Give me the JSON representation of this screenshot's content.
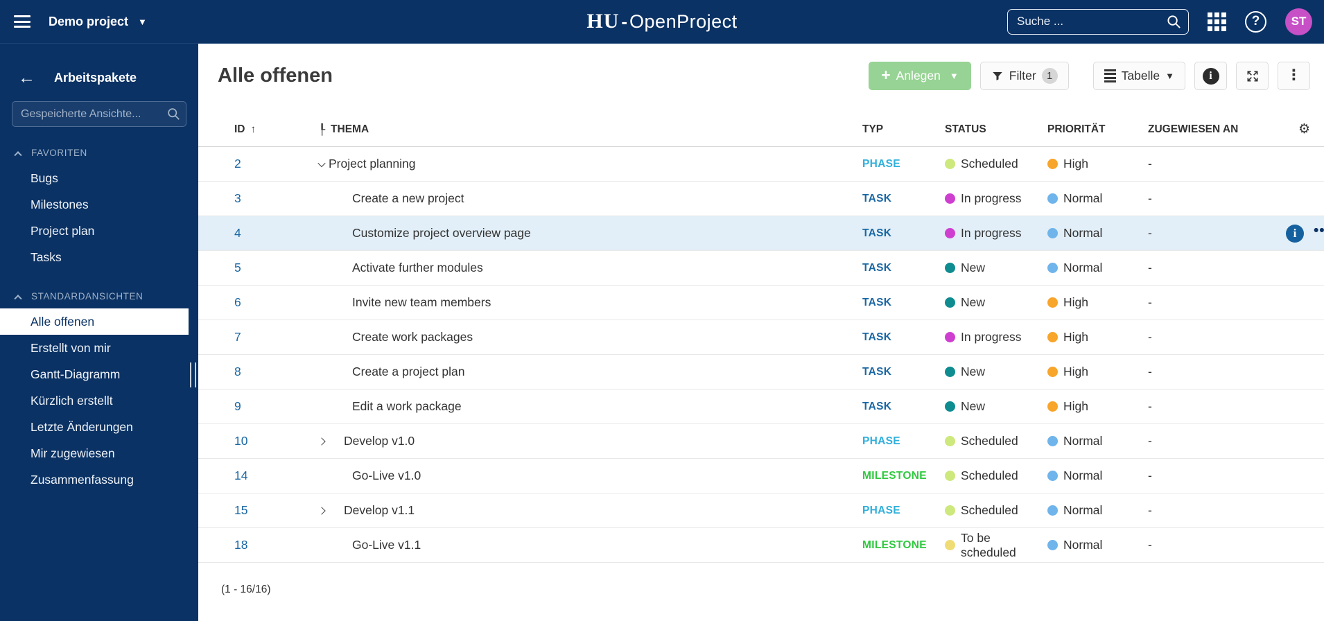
{
  "topbar": {
    "project_name": "Demo project",
    "logo": {
      "serif": "HU",
      "dash": "-",
      "sans": "OpenProject"
    },
    "search_placeholder": "Suche ...",
    "avatar_initials": "ST"
  },
  "sidebar": {
    "title": "Arbeitspakete",
    "search_placeholder": "Gespeicherte Ansichte...",
    "sections": [
      {
        "label": "FAVORITEN",
        "items": [
          {
            "label": "Bugs",
            "selected": false
          },
          {
            "label": "Milestones",
            "selected": false
          },
          {
            "label": "Project plan",
            "selected": false
          },
          {
            "label": "Tasks",
            "selected": false
          }
        ]
      },
      {
        "label": "STANDARDANSICHTEN",
        "items": [
          {
            "label": "Alle offenen",
            "selected": true
          },
          {
            "label": "Erstellt von mir",
            "selected": false
          },
          {
            "label": "Gantt-Diagramm",
            "selected": false
          },
          {
            "label": "Kürzlich erstellt",
            "selected": false
          },
          {
            "label": "Letzte Änderungen",
            "selected": false
          },
          {
            "label": "Mir zugewiesen",
            "selected": false
          },
          {
            "label": "Zusammenfassung",
            "selected": false
          }
        ]
      }
    ]
  },
  "main": {
    "title": "Alle offenen",
    "toolbar": {
      "create_label": "Anlegen",
      "filter_label": "Filter",
      "filter_count": "1",
      "table_label": "Tabelle"
    },
    "table": {
      "columns": {
        "id": "ID",
        "thema": "THEMA",
        "typ": "TYP",
        "status": "STATUS",
        "prioritaet": "PRIORITÄT",
        "zugewiesen": "ZUGEWIESEN AN"
      },
      "rows": [
        {
          "id": "2",
          "subject": "Project planning",
          "level": 0,
          "chevron": "down",
          "type": "PHASE",
          "type_color": "#2FB0DC",
          "status": "Scheduled",
          "status_color": "#CDE87C",
          "priority": "High",
          "priority_color": "#F7A52B",
          "assignee": "-",
          "highlighted": false
        },
        {
          "id": "3",
          "subject": "Create a new project",
          "level": 1,
          "chevron": null,
          "type": "TASK",
          "type_color": "#1A67A3",
          "status": "In progress",
          "status_color": "#CE3FD0",
          "priority": "Normal",
          "priority_color": "#6FB4EB",
          "assignee": "-",
          "highlighted": false
        },
        {
          "id": "4",
          "subject": "Customize project overview page",
          "level": 1,
          "chevron": null,
          "type": "TASK",
          "type_color": "#1A67A3",
          "status": "In progress",
          "status_color": "#CE3FD0",
          "priority": "Normal",
          "priority_color": "#6FB4EB",
          "assignee": "-",
          "highlighted": true
        },
        {
          "id": "5",
          "subject": "Activate further modules",
          "level": 1,
          "chevron": null,
          "type": "TASK",
          "type_color": "#1A67A3",
          "status": "New",
          "status_color": "#0E8C90",
          "priority": "Normal",
          "priority_color": "#6FB4EB",
          "assignee": "-",
          "highlighted": false
        },
        {
          "id": "6",
          "subject": "Invite new team members",
          "level": 1,
          "chevron": null,
          "type": "TASK",
          "type_color": "#1A67A3",
          "status": "New",
          "status_color": "#0E8C90",
          "priority": "High",
          "priority_color": "#F7A52B",
          "assignee": "-",
          "highlighted": false
        },
        {
          "id": "7",
          "subject": "Create work packages",
          "level": 1,
          "chevron": null,
          "type": "TASK",
          "type_color": "#1A67A3",
          "status": "In progress",
          "status_color": "#CE3FD0",
          "priority": "High",
          "priority_color": "#F7A52B",
          "assignee": "-",
          "highlighted": false
        },
        {
          "id": "8",
          "subject": "Create a project plan",
          "level": 1,
          "chevron": null,
          "type": "TASK",
          "type_color": "#1A67A3",
          "status": "New",
          "status_color": "#0E8C90",
          "priority": "High",
          "priority_color": "#F7A52B",
          "assignee": "-",
          "highlighted": false
        },
        {
          "id": "9",
          "subject": "Edit a work package",
          "level": 1,
          "chevron": null,
          "type": "TASK",
          "type_color": "#1A67A3",
          "status": "New",
          "status_color": "#0E8C90",
          "priority": "High",
          "priority_color": "#F7A52B",
          "assignee": "-",
          "highlighted": false
        },
        {
          "id": "10",
          "subject": "Develop v1.0",
          "level": 0,
          "chevron": "right",
          "type": "PHASE",
          "type_color": "#2FB0DC",
          "status": "Scheduled",
          "status_color": "#CDE87C",
          "priority": "Normal",
          "priority_color": "#6FB4EB",
          "assignee": "-",
          "highlighted": false
        },
        {
          "id": "14",
          "subject": "Go-Live v1.0",
          "level": 1,
          "chevron": null,
          "type": "MILESTONE",
          "type_color": "#30C940",
          "status": "Scheduled",
          "status_color": "#CDE87C",
          "priority": "Normal",
          "priority_color": "#6FB4EB",
          "assignee": "-",
          "highlighted": false
        },
        {
          "id": "15",
          "subject": "Develop v1.1",
          "level": 0,
          "chevron": "right",
          "type": "PHASE",
          "type_color": "#2FB0DC",
          "status": "Scheduled",
          "status_color": "#CDE87C",
          "priority": "Normal",
          "priority_color": "#6FB4EB",
          "assignee": "-",
          "highlighted": false
        },
        {
          "id": "18",
          "subject": "Go-Live v1.1",
          "level": 1,
          "chevron": null,
          "type": "MILESTONE",
          "type_color": "#30C940",
          "status": "To be scheduled",
          "status_color": "#EFDC75",
          "priority": "Normal",
          "priority_color": "#6FB4EB",
          "assignee": "-",
          "highlighted": false
        }
      ]
    },
    "footer_count": "(1 - 16/16)"
  },
  "icons": {
    "hamburger": "menu",
    "magnifier": "search",
    "apps": "grid-3x3",
    "help": "question-circle",
    "filter": "funnel",
    "table": "lines",
    "info": "info-circle",
    "fullscreen": "expand-arrows",
    "kebab": "vertical-ellipsis",
    "gear": "settings",
    "sort": "arrow-up",
    "hierarchy": "tree"
  },
  "colors": {
    "navy": "#0B3264",
    "accent_green": "#97D394",
    "avatar": "#C750C7",
    "link_blue": "#1A67A3",
    "highlight_row": "#E2EFF8"
  }
}
